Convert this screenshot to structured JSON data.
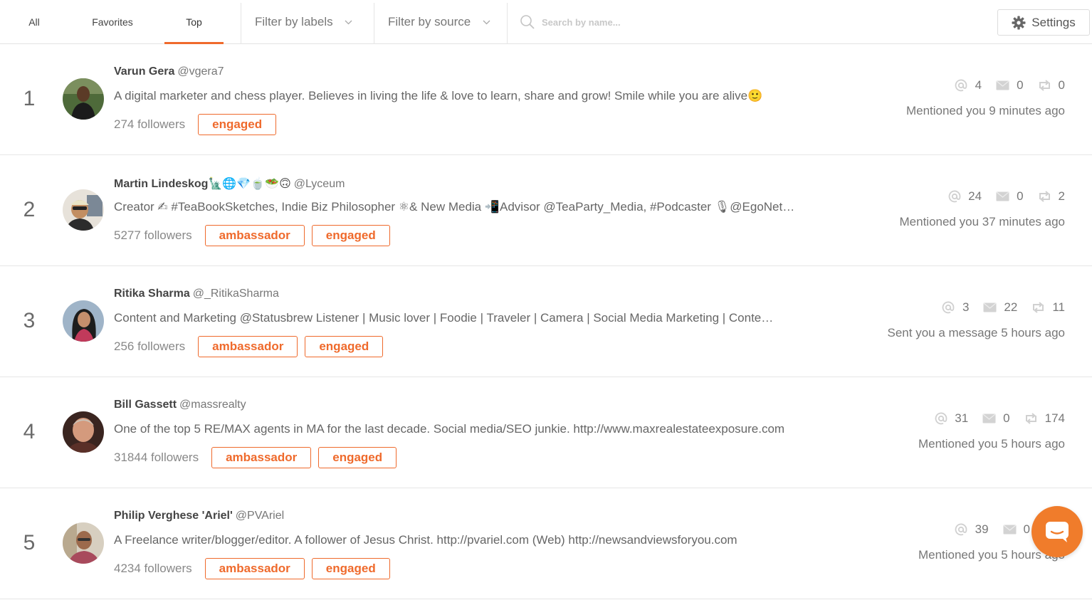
{
  "tabs": [
    {
      "label": "All"
    },
    {
      "label": "Favorites"
    },
    {
      "label": "Top"
    }
  ],
  "filters": {
    "labels": "Filter by labels",
    "source": "Filter by source"
  },
  "search": {
    "placeholder": "Search by name..."
  },
  "settings": {
    "label": "Settings"
  },
  "colors": {
    "accent": "#ef6a2c",
    "chat": "#f07c2b"
  },
  "users": [
    {
      "rank": "1",
      "name": "Varun Gera",
      "handle": "@vgera7",
      "bio": "A digital marketer and chess player. Believes in living the life & love to learn, share and grow! Smile while you are alive🙂",
      "followers": "274 followers",
      "tags": [
        "engaged"
      ],
      "mentions": "4",
      "messages": "0",
      "retweets": "0",
      "activity": "Mentioned you 9 minutes ago"
    },
    {
      "rank": "2",
      "name": "Martin Lindeskog🗽🌐💎🍵🥗🙃",
      "handle": "@Lyceum",
      "bio": "Creator ✍ #TeaBookSketches, Indie Biz Philosopher ⚛& New Media 📲Advisor @TeaParty_Media, #Podcaster 🎙@EgoNet…",
      "followers": "5277 followers",
      "tags": [
        "ambassador",
        "engaged"
      ],
      "mentions": "24",
      "messages": "0",
      "retweets": "2",
      "activity": "Mentioned you 37 minutes ago"
    },
    {
      "rank": "3",
      "name": "Ritika Sharma",
      "handle": "@_RitikaSharma",
      "bio": "Content and Marketing @Statusbrew Listener | Music lover | Foodie | Traveler | Camera | Social Media Marketing | Conte…",
      "followers": "256 followers",
      "tags": [
        "ambassador",
        "engaged"
      ],
      "mentions": "3",
      "messages": "22",
      "retweets": "11",
      "activity": "Sent you a message 5 hours ago"
    },
    {
      "rank": "4",
      "name": "Bill Gassett",
      "handle": "@massrealty",
      "bio": "One of the top 5 RE/MAX agents in MA for the last decade. Social media/SEO junkie. http://www.maxrealestateexposure.com",
      "followers": "31844 followers",
      "tags": [
        "ambassador",
        "engaged"
      ],
      "mentions": "31",
      "messages": "0",
      "retweets": "174",
      "activity": "Mentioned you 5 hours ago"
    },
    {
      "rank": "5",
      "name": "Philip Verghese 'Ariel'",
      "handle": "@PVAriel",
      "bio": "A Freelance writer/blogger/editor. A follower of Jesus Christ. http://pvariel.com (Web) http://newsandviewsforyou.com",
      "followers": "4234 followers",
      "tags": [
        "ambassador",
        "engaged"
      ],
      "mentions": "39",
      "messages": "0",
      "retweets": "",
      "activity": "Mentioned you 5 hours ago"
    }
  ]
}
